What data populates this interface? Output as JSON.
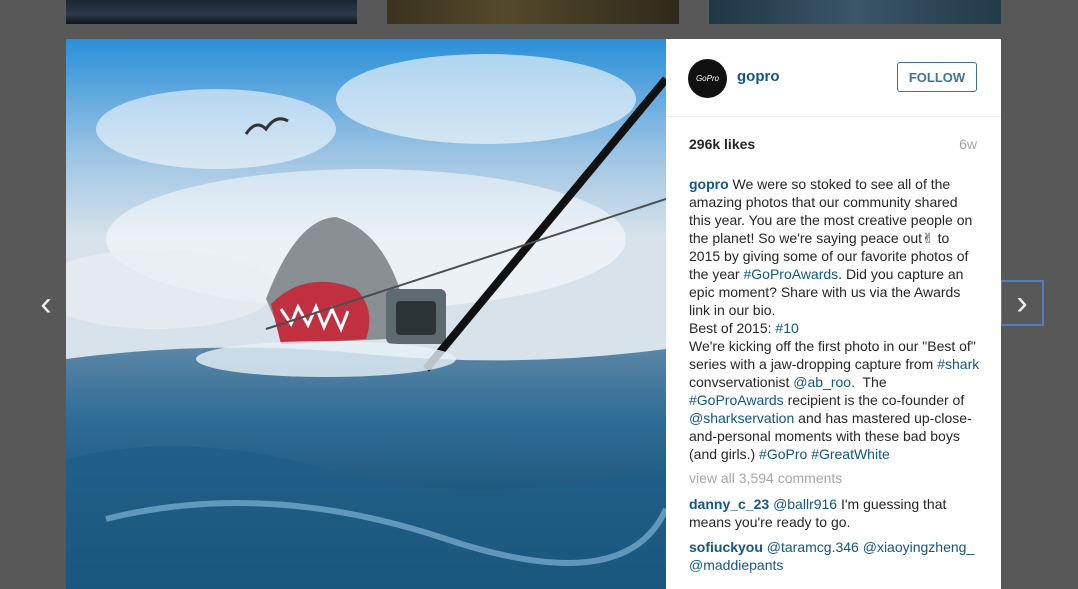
{
  "nav": {
    "prev_icon": "‹",
    "next_icon": "›"
  },
  "post": {
    "username": "gopro",
    "avatar_text": "GoPro",
    "follow_label": "FOLLOW",
    "likes": "296k likes",
    "age": "6w",
    "caption": {
      "author": "gopro",
      "p1": " We were so stoked to see all of the amazing photos that our community shared this year. You are the most creative people on the planet! So we're saying peace out✌ to 2015 by giving some of our favorite photos of the year ",
      "tag1": "#GoProAwards",
      "p2": ". Did you capture an epic moment? Share with us via the Awards link in our bio.\nBest of 2015: ",
      "tag2": "#10",
      "p3": "\nWe're kicking off the first photo in our \"Best of\" series with a jaw-dropping capture from ",
      "tag3": "#shark",
      "p4": " convservationist ",
      "tag4": "@ab_roo",
      "p5": ".  The ",
      "tag5": "#GoProAwards",
      "p6": " recipient is the co-founder of ",
      "tag6": "@sharkservation",
      "p7": " and has mastered up-close-and-personal moments with these bad boys (and girls.) ",
      "tag7": "#GoPro",
      "tag8": "#GreatWhite"
    },
    "view_all": "view all 3,594 comments",
    "comments": [
      {
        "user": "danny_c_23",
        "mention": "@ballr916",
        "text": " I'm guessing that means you're ready to go."
      },
      {
        "user": "sofiuckyou",
        "mention": "@taramcg.346",
        "mention2": "@xiaoyingzheng_",
        "mention3": "@maddiepants"
      }
    ]
  },
  "colors": {
    "link": "#125688",
    "follow": "#3f729b",
    "muted": "#a5a7aa",
    "overlay": "#585858"
  }
}
